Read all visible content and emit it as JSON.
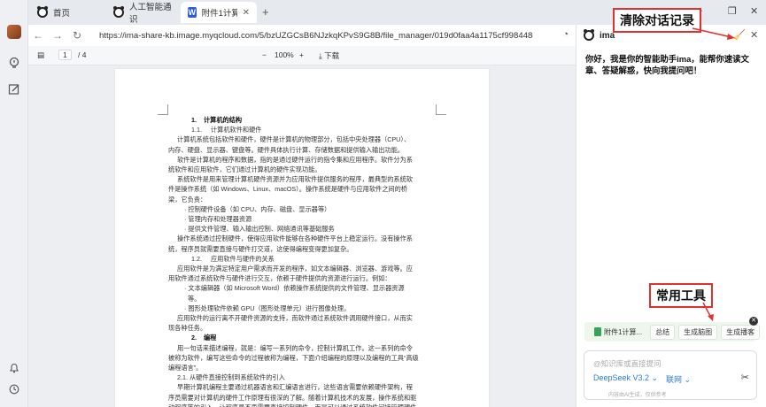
{
  "tabs": [
    {
      "label": "首页",
      "icon": "panda-icon"
    },
    {
      "label": "人工智能通识",
      "icon": "panda-icon"
    },
    {
      "label": "附件1计算机基",
      "icon": "word-icon",
      "active": true
    }
  ],
  "address": {
    "url": "https://ima-share-kb.image.myqcloud.com/5/bzUZGCsB6NJzkqKPvS9G8B/file_manager/019d0faa4a1175cf998448d433ae6942.d..."
  },
  "pdf_toolbar": {
    "page_current": "1",
    "page_sep_total": "/ 4",
    "zoom": "100%",
    "download": "下载"
  },
  "document": {
    "lines": [
      {
        "text": "1.    计算机的结构",
        "indent": 1,
        "bold": true
      },
      {
        "text": "1.1.     计算机软件和硬件",
        "indent": 1
      },
      {
        "text": "计算机系统包括软件和硬件，硬件是计算机的物理部分，包括中央处理器（CPU）、",
        "indent": 2
      },
      {
        "text": "内存、硬盘、显示器、键盘等。硬件具体执行计算、存储数据和提供输入输出功能。",
        "indent": 0
      },
      {
        "text": "软件是计算机的程序和数据，指的是通过硬件运行的指令集和应用程序。软件分为系",
        "indent": 2
      },
      {
        "text": "统软件和应用软件，它们通过计算机的硬件实现功能。",
        "indent": 0
      },
      {
        "text": "系统软件是用来管理计算机硬件资源并为应用软件提供服务的程序，最典型的系统软",
        "indent": 2
      },
      {
        "text": "件是操作系统（如 Windows、Linux、macOS）。操作系统是硬件与应用软件之间的桥",
        "indent": 0
      },
      {
        "text": "梁，它负责：",
        "indent": 0
      },
      {
        "text": "· 控制硬件设备（如 CPU、内存、磁盘、显示器等）",
        "indent": 3
      },
      {
        "text": "· 管理内存和处理器资源",
        "indent": 3
      },
      {
        "text": "· 提供文件管理、输入输出控制、网络通讯等基础服务",
        "indent": 3
      },
      {
        "text": "操作系统通过控制硬件，使得应用软件能够在各种硬件平台上稳定运行。没有操作系",
        "indent": 2
      },
      {
        "text": "统，程序员就需要直接与硬件打交道，这使得编程变得更加复杂。",
        "indent": 0
      },
      {
        "text": "1.2.     应用软件与硬件的关系",
        "indent": 1
      },
      {
        "text": "应用软件是为满足特定用户需求而开发的程序，如文本编辑器、浏览器、游戏等。应",
        "indent": 2
      },
      {
        "text": "用软件通过系统软件与硬件进行交互，依赖于硬件提供的资源进行运行。例如：",
        "indent": 0
      },
      {
        "text": "· 文本编辑器（如 Microsoft Word）依赖操作系统提供的文件管理、显示器资源",
        "indent": 3
      },
      {
        "text": "等。",
        "indent": 4
      },
      {
        "text": "· 图形处理软件依赖 GPU（图形处理单元）进行图像处理。",
        "indent": 3
      },
      {
        "text": "应用软件的运行离不开硬件资源的支持，而软件通过系统软件调用硬件接口，从而实",
        "indent": 2
      },
      {
        "text": "现各种任务。",
        "indent": 0
      },
      {
        "text": "2.    编程",
        "indent": 1,
        "bold": true
      },
      {
        "text": "用一句话来描述编程，就是：编写一系列的命令，控制计算机工作。这一系列的命令",
        "indent": 2
      },
      {
        "text": "被称为软件，编写这些命令的过程被称为编程，下面介绍编程的原理以及编程的工具“高级",
        "indent": 0
      },
      {
        "text": "编程语言”。",
        "indent": 0
      },
      {
        "text": "2.1. 从硬件直接控制到系统软件的引入",
        "indent": 2
      },
      {
        "text": "早期计算机编程主要通过机器语言和汇编语言进行，这些语言需要依赖硬件架构，程",
        "indent": 2
      },
      {
        "text": "序员需要对计算机的硬件工作原理有很深的了解。随着计算机技术的发展，操作系统和驱",
        "indent": 0
      },
      {
        "text": "动程序等的引入，让程序员不再需要直接控制硬件，而是可以通过系统软件间接管理硬件",
        "indent": 0
      }
    ]
  },
  "panel": {
    "title": "ima",
    "greeting": "你好，我是你的智能助手ima，能帮你速读文章、答疑解惑，快向我提问吧！",
    "chips": {
      "file": "附件1计算...",
      "summary": "总结",
      "outline": "生成脑图",
      "podcast": "生成播客"
    },
    "input_placeholder": "@知识库或直接提问",
    "model": "DeepSeek V3.2 ⌄",
    "network": "联网 ⌄",
    "disclaimer": "内容由AI生成，仅供参考"
  },
  "annotations": {
    "clear_history": "清除对话记录",
    "common_tools": "常用工具"
  },
  "colors": {
    "accent": "#2b7be0",
    "callout_border": "#e03131",
    "tool_row_bg": "#eef7ec"
  }
}
